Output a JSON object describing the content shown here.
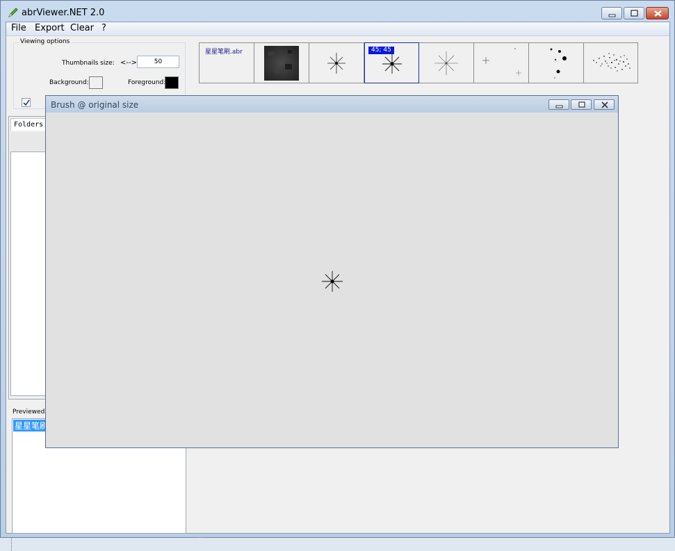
{
  "window": {
    "title": "abrViewer.NET 2.0",
    "icon": "pencil-icon"
  },
  "menu": {
    "items": [
      "File",
      "Export",
      "Clear",
      "?"
    ]
  },
  "viewing_options": {
    "title": "Viewing options",
    "thumb_label": "Thumbnails size:",
    "arrow_label": "<-->",
    "thumb_value": "50",
    "background_label": "Background:",
    "foreground_label": "Foreground:",
    "background_color": "#f0f0f0",
    "foreground_color": "#000000",
    "checkbox_checked": true
  },
  "folders": {
    "tab": "Folders"
  },
  "previewed": {
    "label": "Previewed s",
    "item": "星星笔刷"
  },
  "thumbnails": {
    "file_label": "星星笔刷.abr",
    "selected_size": "45; 45",
    "selected_index": 3
  },
  "preview_window": {
    "title": "Brush @ original size"
  }
}
